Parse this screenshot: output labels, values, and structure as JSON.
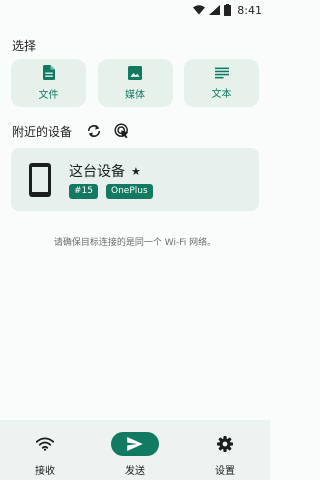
{
  "status_bar": {
    "time": "8:41"
  },
  "select_section": {
    "title": "选择",
    "options": [
      {
        "label": "文件",
        "icon": "file-icon"
      },
      {
        "label": "媒体",
        "icon": "image-icon"
      },
      {
        "label": "文本",
        "icon": "text-icon"
      }
    ]
  },
  "nearby_section": {
    "title": "附近的设备",
    "refresh_icon": "refresh-icon",
    "scan_icon": "touch-scan-icon"
  },
  "device": {
    "name": "这台设备",
    "star": "★",
    "tags": [
      "#15",
      "OnePlus"
    ]
  },
  "hint": "请确保目标连接的是同一个 Wi-Fi 网络。",
  "bottom_nav": [
    {
      "label": "接收",
      "icon": "wifi-icon",
      "active": false
    },
    {
      "label": "发送",
      "icon": "send-icon",
      "active": true
    },
    {
      "label": "设置",
      "icon": "gear-icon",
      "active": false
    }
  ],
  "colors": {
    "accent": "#137a62",
    "card_bg": "#e6f1ec",
    "nav_bg": "#edf3f0"
  }
}
